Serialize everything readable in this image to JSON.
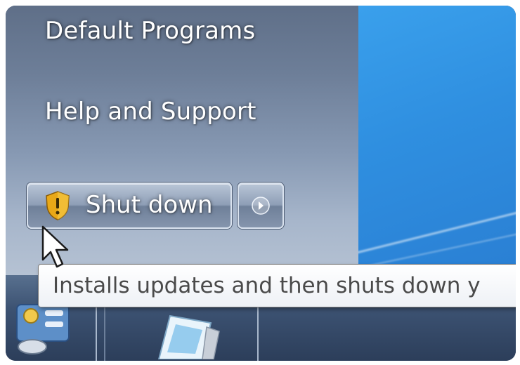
{
  "start_menu": {
    "items": [
      {
        "label": "Default Programs"
      },
      {
        "label": "Help and Support"
      }
    ],
    "shutdown": {
      "label": "Shut down",
      "icon": "uac-shield-icon",
      "options_icon": "right-arrow-icon"
    }
  },
  "tooltip": {
    "text": "Installs updates and then shuts down y"
  },
  "colors": {
    "start_pane_top": "#5f6f88",
    "start_pane_bottom": "#b5c2d3",
    "desktop_blue": "#2f8fe0",
    "taskbar": "#3c5272",
    "shield_yellow": "#f2b61c"
  }
}
